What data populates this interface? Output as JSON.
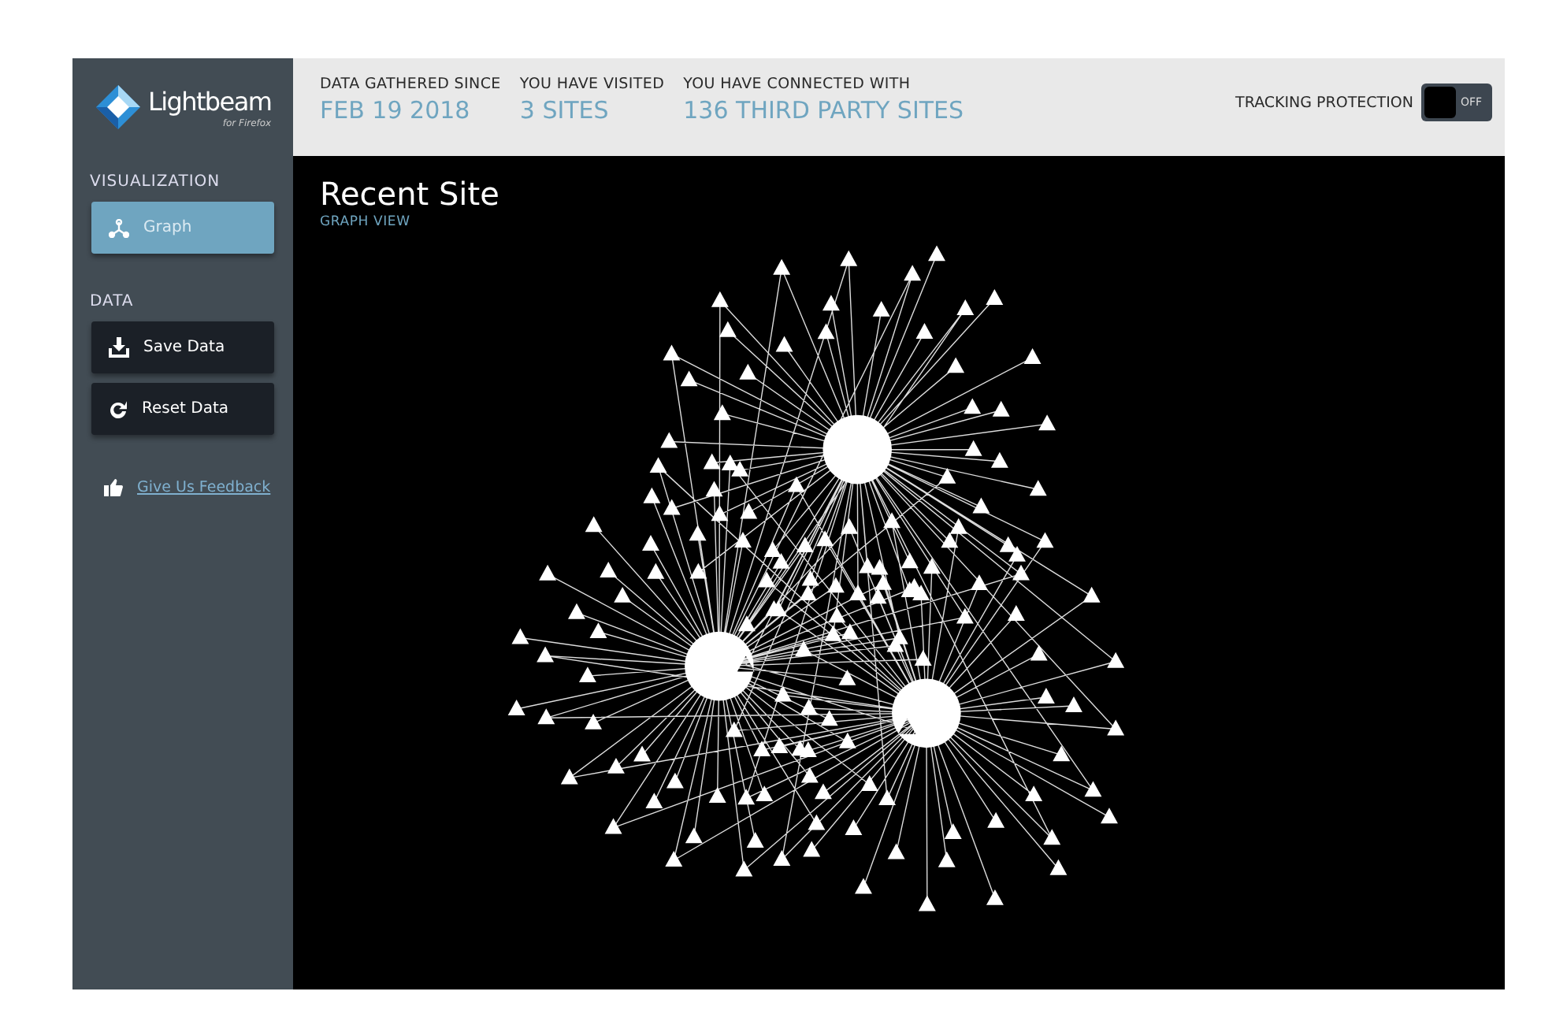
{
  "brand": {
    "name": "Lightbeam",
    "subtitle": "for Firefox"
  },
  "sidebar": {
    "sections": [
      {
        "title": "VISUALIZATION",
        "items": [
          {
            "label": "Graph",
            "kind": "graph",
            "selected": true
          }
        ]
      },
      {
        "title": "DATA",
        "items": [
          {
            "label": "Save Data",
            "kind": "save",
            "selected": false
          },
          {
            "label": "Reset Data",
            "kind": "reset",
            "selected": false
          }
        ]
      }
    ],
    "feedback_link": "Give Us Feedback"
  },
  "header": {
    "stats": [
      {
        "label": "DATA GATHERED SINCE",
        "value": "FEB 19 2018"
      },
      {
        "label": "YOU HAVE VISITED",
        "value": "3 SITES"
      },
      {
        "label": "YOU HAVE CONNECTED WITH",
        "value": "136 THIRD PARTY SITES"
      }
    ],
    "tracking_protection": {
      "label": "TRACKING PROTECTION",
      "state_text": "OFF",
      "on": false
    }
  },
  "view": {
    "title": "Recent Site",
    "subtitle": "GRAPH VIEW"
  }
}
